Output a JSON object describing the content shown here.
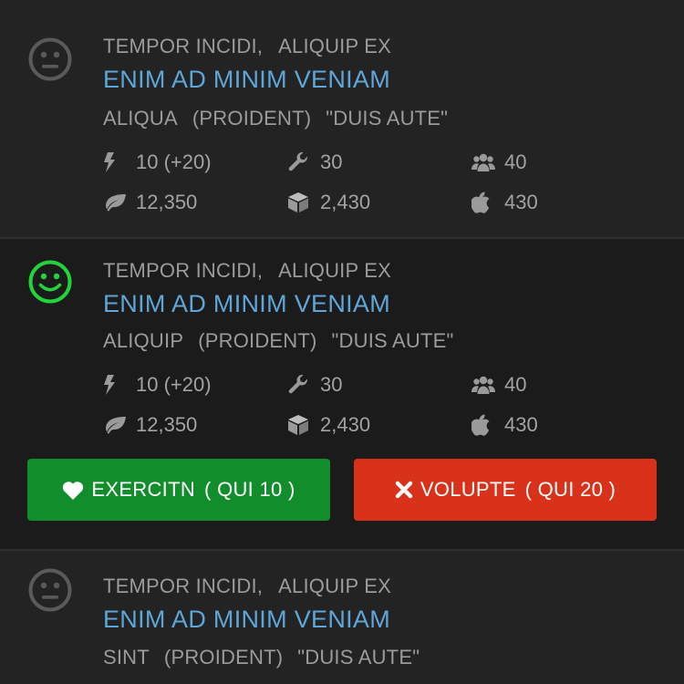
{
  "colors": {
    "accent_title": "#5fa6d8",
    "muted_text": "#9b9b9b",
    "happy_face": "#22d43a",
    "neutral_face": "#5a5a5a",
    "like_button": "#118d2b",
    "nope_button": "#d8331a"
  },
  "cards": [
    {
      "mood": "neutral",
      "line1_a": "TEMPOR INCIDI,",
      "line1_b": "ALIQUIP EX",
      "title": "ENIM AD MINIM VENIAM",
      "line3_a": "ALIQUA",
      "line3_b": "(PROIDENT)",
      "line3_c": "\"DUIS AUTE\"",
      "stats": {
        "bolt": "10 (+20)",
        "wrench": "30",
        "group": "40",
        "leaf": "12,350",
        "cube": "2,430",
        "apple": "430"
      }
    },
    {
      "mood": "happy",
      "line1_a": "TEMPOR INCIDI,",
      "line1_b": "ALIQUIP EX",
      "title": "ENIM AD MINIM VENIAM",
      "line3_a": "ALIQUIP",
      "line3_b": "(PROIDENT)",
      "line3_c": "\"DUIS AUTE\"",
      "stats": {
        "bolt": "10 (+20)",
        "wrench": "30",
        "group": "40",
        "leaf": "12,350",
        "cube": "2,430",
        "apple": "430"
      },
      "buttons": {
        "like_label": "EXERCITN",
        "like_count": "( QUI 10 )",
        "nope_label": "VOLUPTE",
        "nope_count": "( QUI 20 )"
      }
    },
    {
      "mood": "neutral",
      "line1_a": "TEMPOR INCIDI,",
      "line1_b": "ALIQUIP EX",
      "title": "ENIM AD MINIM VENIAM",
      "line3_a": "SINT",
      "line3_b": "(PROIDENT)",
      "line3_c": "\"DUIS AUTE\""
    }
  ],
  "icons": [
    "neutral-face-icon",
    "happy-face-icon",
    "bolt-icon",
    "wrench-icon",
    "group-icon",
    "leaf-icon",
    "cube-icon",
    "apple-icon",
    "heart-icon",
    "close-icon"
  ]
}
